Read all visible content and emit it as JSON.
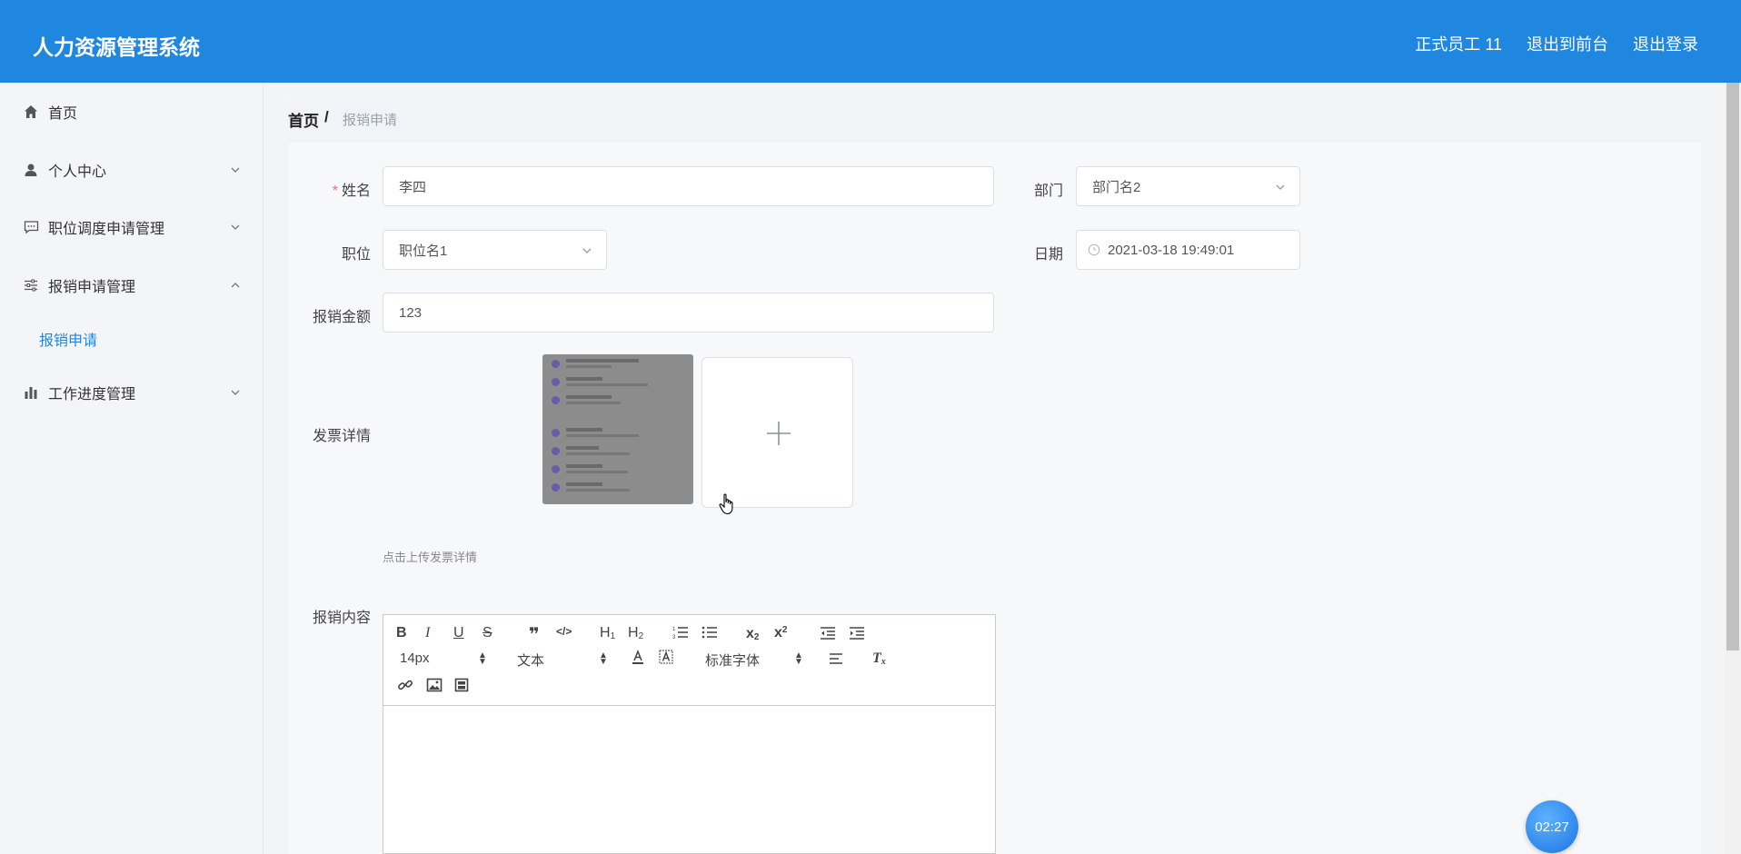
{
  "header": {
    "brand": "人力资源管理系统",
    "user": "正式员工 11",
    "front_link": "退出到前台",
    "logout": "退出登录"
  },
  "sidebar": {
    "items": [
      {
        "label": "首页",
        "icon": "home-icon"
      },
      {
        "label": "个人中心",
        "icon": "user-icon"
      },
      {
        "label": "职位调度申请管理",
        "icon": "message-icon"
      },
      {
        "label": "报销申请管理",
        "icon": "sliders-icon",
        "expanded": true,
        "children": [
          "报销申请"
        ]
      },
      {
        "label": "工作进度管理",
        "icon": "bar-chart-icon"
      }
    ]
  },
  "breadcrumb": {
    "home": "首页",
    "sep": "/",
    "current": "报销申请"
  },
  "form": {
    "name_label": "姓名",
    "name_value": "李四",
    "dept_label": "部门",
    "dept_value": "部门名2",
    "position_label": "职位",
    "position_value": "职位名1",
    "date_label": "日期",
    "date_value": "2021-03-18 19:49:01",
    "amount_label": "报销金额",
    "amount_value": "123",
    "invoice_label": "发票详情",
    "upload_tip": "点击上传发票详情",
    "content_label": "报销内容"
  },
  "editor": {
    "font_size": "14px",
    "block_type": "文本",
    "font_family": "标准字体"
  },
  "timer": "02:27",
  "colors": {
    "primary": "#1f87e0",
    "required": "#f56c6c"
  }
}
